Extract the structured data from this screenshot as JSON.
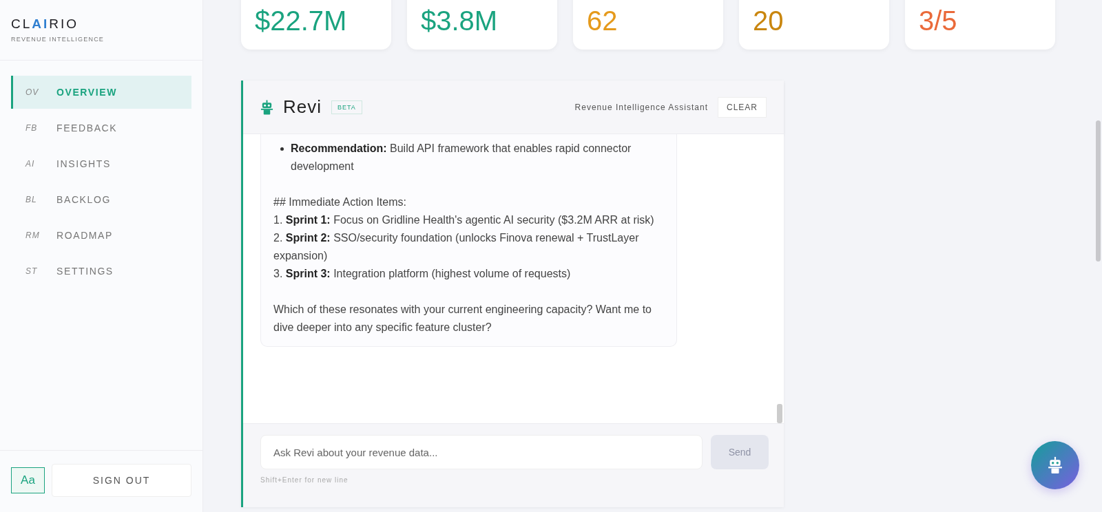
{
  "brand": {
    "name_parts": [
      {
        "text": "CL",
        "accent": false
      },
      {
        "text": "AI",
        "accent": true
      },
      {
        "text": "RIO",
        "accent": false
      }
    ],
    "subtitle": "REVENUE INTELLIGENCE"
  },
  "sidebar": {
    "items": [
      {
        "code": "OV",
        "label": "OVERVIEW",
        "selected": true
      },
      {
        "code": "FB",
        "label": "FEEDBACK",
        "selected": false
      },
      {
        "code": "AI",
        "label": "INSIGHTS",
        "selected": false
      },
      {
        "code": "BL",
        "label": "BACKLOG",
        "selected": false
      },
      {
        "code": "RM",
        "label": "ROADMAP",
        "selected": false
      },
      {
        "code": "ST",
        "label": "SETTINGS",
        "selected": false
      }
    ],
    "font_button": "Aa",
    "sign_out": "SIGN OUT"
  },
  "stats": [
    {
      "value": "$22.7M",
      "color": "#1aa37f"
    },
    {
      "value": "$3.8M",
      "color": "#1aa37f"
    },
    {
      "value": "62",
      "color": "#e59a1c"
    },
    {
      "value": "20",
      "color": "#c9860f"
    },
    {
      "value": "3/5",
      "color": "#ea6a3a"
    }
  ],
  "chat": {
    "title": "Revi",
    "badge": "BETA",
    "subtitle": "Revenue Intelligence Assistant",
    "clear": "CLEAR",
    "message": [
      {
        "kind": "bullet",
        "text": "**Recommendation:** Build API framework that enables rapid connector development"
      },
      {
        "kind": "gap"
      },
      {
        "kind": "line",
        "text": "## Immediate Action Items:"
      },
      {
        "kind": "line",
        "text": "1. **Sprint 1:** Focus on Gridline Health's agentic AI security ($3.2M ARR at risk)"
      },
      {
        "kind": "line",
        "text": "2. **Sprint 2:** SSO/security foundation (unlocks Finova renewal + TrustLayer expansion)"
      },
      {
        "kind": "line",
        "text": "3. **Sprint 3:** Integration platform (highest volume of requests)"
      },
      {
        "kind": "gap"
      },
      {
        "kind": "line",
        "text": "Which of these resonates with your current engineering capacity? Want me to dive deeper into any specific feature cluster?"
      }
    ],
    "input": {
      "placeholder": "Ask Revi about your revenue data..."
    },
    "send": {
      "label": "Send",
      "disabled": true
    },
    "hint": "Shift+Enter for new line"
  }
}
